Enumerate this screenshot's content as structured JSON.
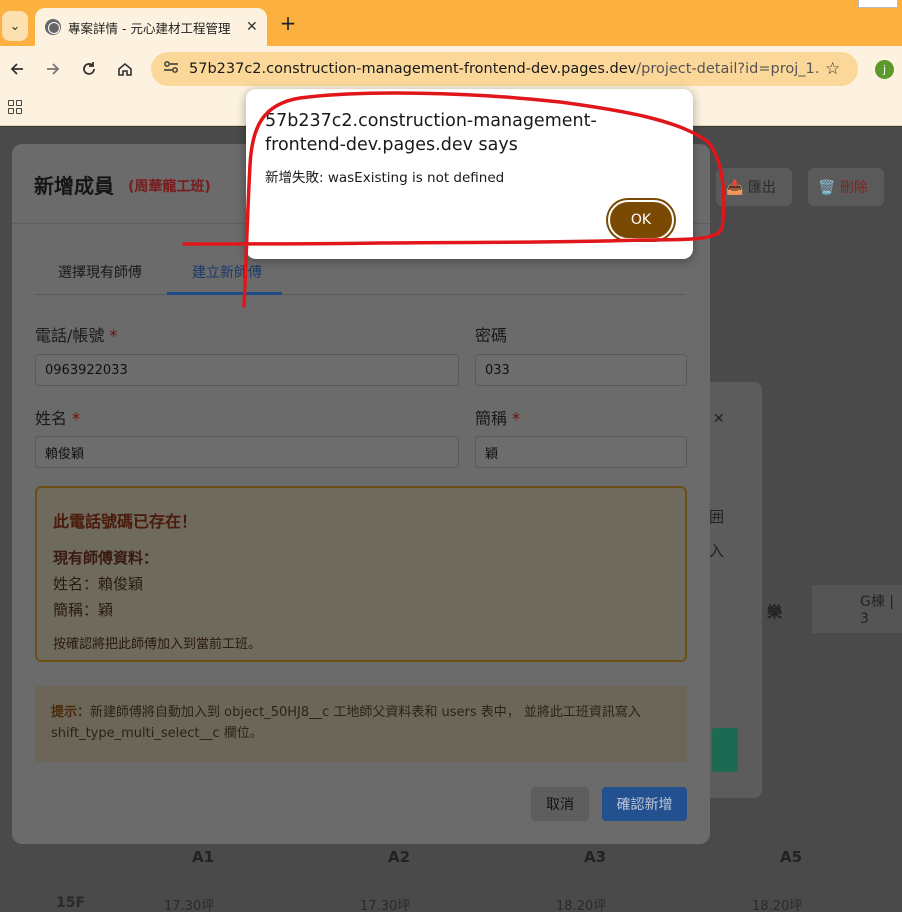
{
  "browser": {
    "tab_title": "專案詳情 - 元心建材工程管理",
    "tab_close": "✕",
    "new_tab": "+",
    "url_host": "57b237c2.construction-management-frontend-dev.pages.dev",
    "url_path": "/project-detail?id=proj_1…",
    "profile_initial": "j"
  },
  "background": {
    "export_label": "📥 匯出",
    "delete_label": "🗑️ 刪除",
    "card_close": "✕",
    "text_a": "囲",
    "text_b": "入",
    "text_c": "樂",
    "building": "G棟 | 3",
    "columns": [
      "A1",
      "A2",
      "A3",
      "A5"
    ],
    "floor": "15F",
    "cells": [
      "17.30坪",
      "17.30坪",
      "18.20坪",
      "18.20坪"
    ]
  },
  "modal": {
    "title": "新增成員",
    "subtitle": "(周華龍工班)",
    "tabs": [
      "選擇現有師傅",
      "建立新師傅"
    ],
    "phone_label": "電話/帳號",
    "required_mark": "*",
    "phone_value": "0963922033",
    "password_label": "密碼",
    "password_value": "033",
    "name_label": "姓名",
    "name_value": "賴俊穎",
    "short_label": "簡稱",
    "short_value": "穎",
    "warning": {
      "title": "此電話號碼已存在！",
      "subtitle": "現有師傅資料：",
      "name_line": "姓名：賴俊穎",
      "short_line": "簡稱：穎",
      "note": "按確認將把此師傅加入到當前工班。"
    },
    "hint_label": "提示：",
    "hint_text": "新建師傅將自動加入到 object_50HJ8__c 工地師父資料表和 users 表中， 並將此工班資訊寫入 shift_type_multi_select__c 欄位。",
    "cancel": "取消",
    "confirm": "確認新增"
  },
  "alert": {
    "title": "57b237c2.construction-management-frontend-dev.pages.dev says",
    "message": "新增失敗: wasExisting is not defined",
    "ok": "OK"
  },
  "colors": {
    "chrome": "#fbb040",
    "accent": "#7a4a05",
    "annotation": "#e0161b"
  }
}
